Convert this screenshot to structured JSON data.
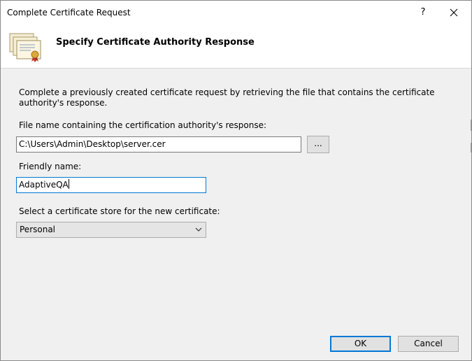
{
  "window": {
    "title": "Complete Certificate Request",
    "help_label": "?"
  },
  "header": {
    "title": "Specify Certificate Authority Response"
  },
  "body": {
    "description": "Complete a previously created certificate request by retrieving the file that contains the certificate authority's response.",
    "file_label": "File name containing the certification authority's response:",
    "file_value": "C:\\Users\\Admin\\Desktop\\server.cer",
    "browse_label": "...",
    "friendly_label": "Friendly name:",
    "friendly_value": "AdaptiveQA",
    "store_label": "Select a certificate store for the new certificate:",
    "store_value": "Personal"
  },
  "footer": {
    "ok_label": "OK",
    "cancel_label": "Cancel"
  },
  "icons": {
    "header_icon": "certificate-icon",
    "close": "close-icon",
    "dropdown": "chevron-down-icon"
  },
  "colors": {
    "accent": "#0078d7",
    "window_bg": "#f0f0f0",
    "header_bg": "#ffffff"
  }
}
